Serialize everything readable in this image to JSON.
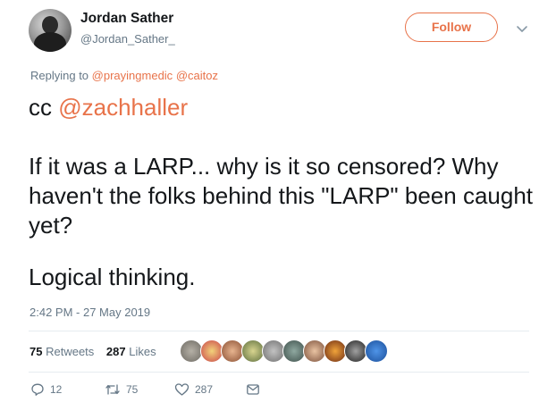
{
  "author": {
    "name": "Jordan Sather",
    "handle": "@Jordan_Sather_"
  },
  "follow_label": "Follow",
  "replying": {
    "prefix": "Replying to",
    "mentions": [
      "@prayingmedic",
      "@caitoz"
    ]
  },
  "tweet": {
    "cc_prefix": "cc",
    "cc_mention": "@zachhaller",
    "body": "If it was a LARP... why is it so censored? Why haven't the folks behind this \"LARP\" been caught yet?",
    "closing": "Logical thinking.",
    "timestamp": "2:42 PM - 27 May 2019"
  },
  "stats": {
    "retweets_count": "75",
    "retweets_label": "Retweets",
    "likes_count": "287",
    "likes_label": "Likes"
  },
  "liker_avatars": [
    "avatar-1",
    "avatar-2",
    "avatar-3",
    "avatar-4",
    "avatar-5",
    "avatar-6",
    "avatar-7",
    "avatar-8",
    "avatar-9",
    "avatar-10"
  ],
  "actions": {
    "reply_count": "12",
    "retweet_count": "75",
    "like_count": "287"
  },
  "colors": {
    "accent": "#e8734a",
    "secondary_text": "#657786",
    "primary_text": "#14171a"
  },
  "icons": [
    "chevron-down-icon",
    "reply-icon",
    "retweet-icon",
    "heart-icon",
    "message-icon"
  ]
}
